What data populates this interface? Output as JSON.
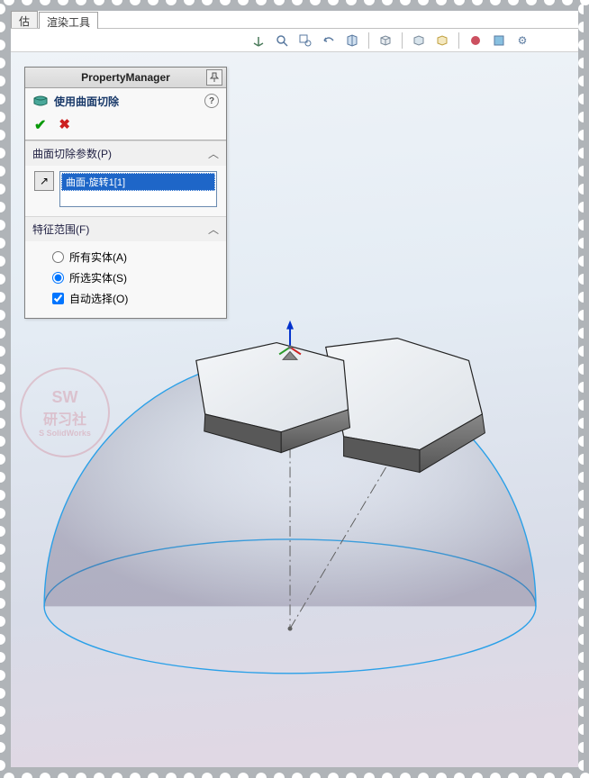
{
  "tabs": {
    "t1": "估",
    "t2": "渲染工具"
  },
  "pm": {
    "title": "PropertyManager",
    "feature_name": "使用曲面切除",
    "sec1_title": "曲面切除参数(P)",
    "selection_item": "曲面-旋转1[1]",
    "sec2_title": "特征范围(F)",
    "opt_all": "所有实体(A)",
    "opt_sel": "所选实体(S)",
    "chk_auto": "自动选择(O)"
  },
  "watermark": {
    "l1": "SW",
    "l2": "研习社",
    "l3": "S SolidWorks"
  }
}
